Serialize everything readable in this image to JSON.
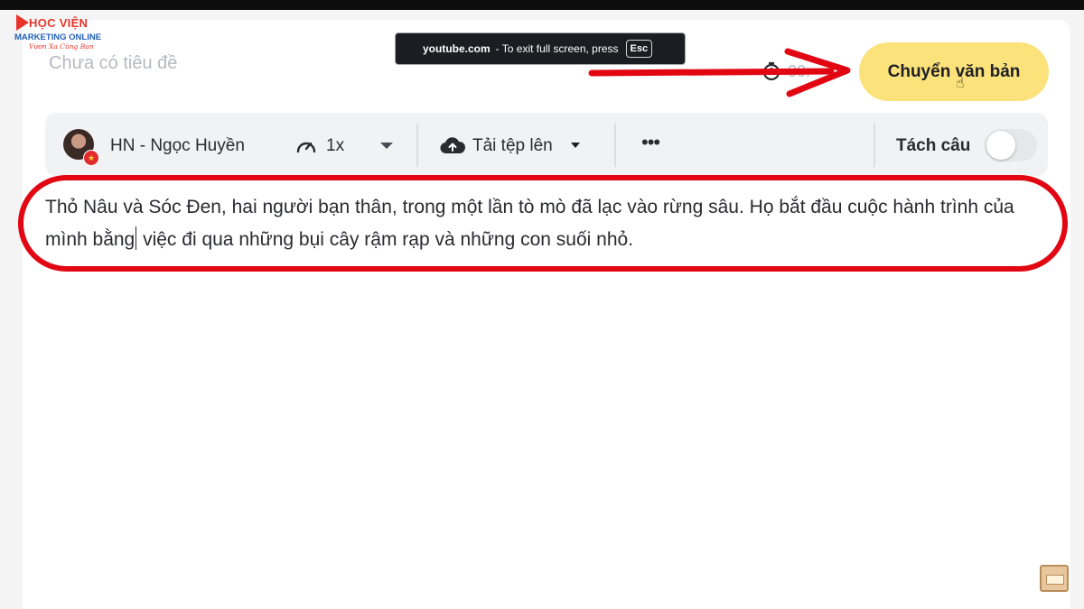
{
  "logo": {
    "line1": "HỌC VIỆN",
    "line2": "MARKETING ONLINE",
    "line3": "Vươn Xa Cùng Bạn"
  },
  "document": {
    "title": "Chưa có tiêu đề"
  },
  "fullscreen_notice": {
    "host": "youtube.com",
    "message": "- To exit full screen, press",
    "key": "Esc"
  },
  "header": {
    "timer_value": "00:",
    "convert_button": "Chuyển văn bản"
  },
  "toolbar": {
    "voice_name": "HN - Ngọc Huyền",
    "speed": "1x",
    "upload_label": "Tải tệp lên",
    "more_label": "•••",
    "split_label": "Tách câu",
    "split_enabled": false
  },
  "editor": {
    "text_before_cursor": "Thỏ Nâu và Sóc Đen, hai người bạn thân, trong một lần tò mò đã lạc vào rừng sâu. Họ bắt đầu cuộc hành trình của mình bằng",
    "text_after_cursor": " việc đi qua những bụi cây rậm rạp và những con suối nhỏ."
  },
  "annotations": {
    "accent_color": "#e20613",
    "button_color": "#fbe27b"
  }
}
